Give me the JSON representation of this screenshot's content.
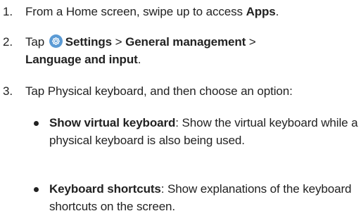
{
  "steps": [
    {
      "number": "1.",
      "text_before": "From a Home screen, swipe up to access ",
      "bold": "Apps",
      "text_after": "."
    },
    {
      "number": "2.",
      "tap": "Tap",
      "settings": "Settings",
      "sep1": " > ",
      "general": "General management",
      "sep2": " >",
      "language": "Language and input",
      "end": "."
    },
    {
      "number": "3.",
      "text": "Tap Physical keyboard, and then choose an option:"
    }
  ],
  "options": [
    {
      "title": "Show virtual keyboard",
      "description": ": Show the virtual keyboard while a physical keyboard is also being used."
    },
    {
      "title": "Keyboard shortcuts",
      "description": ": Show explanations of the keyboard shortcuts on the screen."
    }
  ],
  "icons": {
    "settings_icon": "gear-icon",
    "settings_icon_color": "#5b9bd5"
  }
}
